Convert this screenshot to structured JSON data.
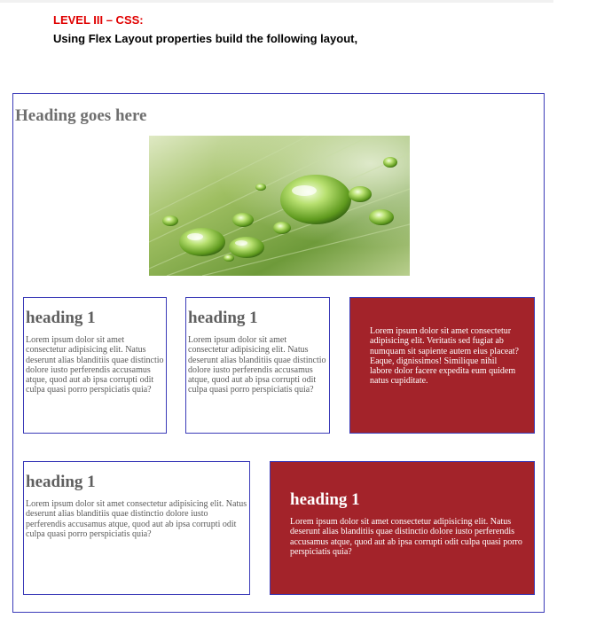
{
  "document": {
    "level_label": "LEVEL III – CSS:",
    "instruction": "Using Flex Layout properties build the following layout,"
  },
  "layout": {
    "heading": "Heading goes here",
    "image": {
      "icon": "leaf-water-droplets-photo"
    },
    "cards_row1": [
      {
        "heading": "heading 1",
        "text": "Lorem ipsum dolor sit amet consectetur adipisicing elit. Natus deserunt alias blanditiis quae distinctio dolore iusto perferendis accusamus atque, quod aut ab ipsa corrupti odit culpa quasi porro perspiciatis quia?"
      },
      {
        "heading": "heading 1",
        "text": "Lorem ipsum dolor sit amet consectetur adipisicing elit. Natus deserunt alias blanditiis quae distinctio dolore iusto perferendis accusamus atque, quod aut ab ipsa corrupti odit culpa quasi porro perspiciatis quia?"
      },
      {
        "text": "Lorem ipsum dolor sit amet consectetur adipisicing elit. Veritatis sed fugiat ab numquam sit sapiente autem eius placeat? Eaque, dignissimos! Similique nihil labore dolor facere expedita eum quidem natus cupiditate."
      }
    ],
    "cards_row2": [
      {
        "heading": "heading 1",
        "text": "Lorem ipsum dolor sit amet consectetur adipisicing elit. Natus deserunt alias blanditiis quae distinctio dolore iusto perferendis accusamus atque, quod aut ab ipsa corrupti odit culpa quasi porro perspiciatis quia?"
      },
      {
        "heading": "heading 1",
        "text": "Lorem ipsum dolor sit amet consectetur adipisicing elit. Natus deserunt alias blanditiis quae distinctio dolore iusto perferendis accusamus atque, quod aut ab ipsa corrupti odit culpa quasi porro perspiciatis quia?"
      }
    ]
  },
  "colors": {
    "level_label": "#e00000",
    "frame_border": "#3b3bb8",
    "red_card": "#a3232a",
    "heading_gray": "#6f6f6f"
  }
}
